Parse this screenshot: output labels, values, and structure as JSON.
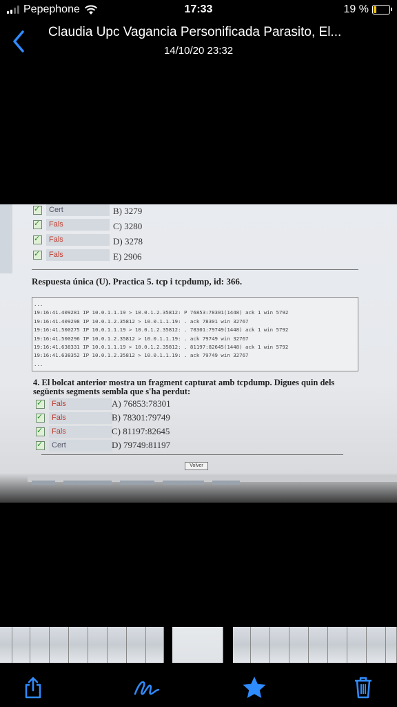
{
  "status": {
    "carrier": "Pepephone",
    "time": "17:33",
    "battery": "19 %",
    "battery_level": 0.19
  },
  "nav": {
    "title": "Claudia Upc Vagancia Personificada Parasito, El...",
    "date": "14/10/20 23:32"
  },
  "photo": {
    "top_options": [
      {
        "status": "Cert",
        "answer": "B) 3279"
      },
      {
        "status": "Fals",
        "answer": "C) 3280"
      },
      {
        "status": "Fals",
        "answer": "D) 3278"
      },
      {
        "status": "Fals",
        "answer": "E) 2906"
      }
    ],
    "question_header": "Respuesta única (U).   Practica 5. tcp i tcpdump, id: 366.",
    "code_lines": [
      "...",
      "19:16:41.409281 IP 10.0.1.1.19 > 10.0.1.2.35812: P 76853:78301(1448) ack 1 win 5792",
      "19:16:41.409298 IP 10.0.1.2.35812 > 10.0.1.1.19: . ack 78301 win 32767",
      "19:16:41.500275 IP 10.0.1.1.19 > 10.0.1.2.35812: . 78301:79749(1448) ack 1 win 5792",
      "19:16:41.500296 IP 10.0.1.2.35812 > 10.0.1.1.19: . ack 79749 win 32767",
      "19:16:41.638331 IP 10.0.1.1.19 > 10.0.1.2.35812: . 81197:82645(1448) ack 1 win 5792",
      "19:16:41.638352 IP 10.0.1.2.35812 > 10.0.1.1.19: . ack 79749 win 32767",
      "..."
    ],
    "question_text": "4. El bolcat anterior mostra un fragment capturat amb tcpdump. Digues quin dels següents segments sembla que s'ha perdut:",
    "options": [
      {
        "status": "Fals",
        "answer": "A) 76853:78301"
      },
      {
        "status": "Fals",
        "answer": "B) 78301:79749"
      },
      {
        "status": "Fals",
        "answer": "C) 81197:82645"
      },
      {
        "status": "Cert",
        "answer": "D) 79749:81197"
      }
    ],
    "button": "Volver"
  },
  "toolbar": {
    "share": "share-icon",
    "edit": "markup-icon",
    "favorite": "star-icon",
    "delete": "trash-icon",
    "accent": "#2f8cff"
  }
}
